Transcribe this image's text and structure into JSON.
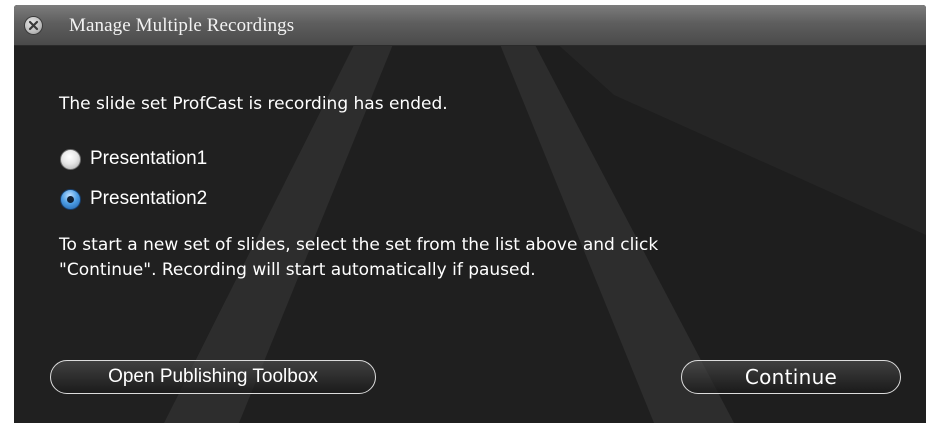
{
  "window": {
    "title": "Manage Multiple Recordings",
    "close_icon": "close-icon"
  },
  "content": {
    "message": "The slide set ProfCast is recording has ended.",
    "options": [
      {
        "label": "Presentation1",
        "selected": false
      },
      {
        "label": "Presentation2",
        "selected": true
      }
    ],
    "instructions": [
      "To start a new set of slides, select the set from the list above and click",
      "\"Continue\". Recording will start automatically if paused."
    ]
  },
  "buttons": {
    "open_publishing_toolbox": "Open Publishing Toolbox",
    "continue": "Continue"
  },
  "colors": {
    "background": "#1e1e1e",
    "titlebar": "#5e5e5e",
    "text": "#ffffff",
    "radio_selected": "#4f9fe6"
  }
}
